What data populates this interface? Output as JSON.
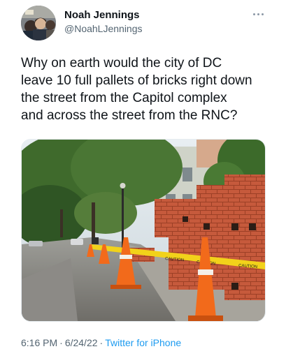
{
  "author": {
    "name": "Noah Jennings",
    "handle": "@NoahLJennings"
  },
  "tweet": {
    "text": "Why on earth would the city of DC\nleave 10 full pallets of bricks right down\nthe street from the Capitol complex\nand across the street from the RNC?"
  },
  "photo": {
    "tape_text_1": "CAUTION",
    "tape_text_2": "CAUTION",
    "tape_text_3": "CAUTION"
  },
  "meta": {
    "time": "6:16 PM",
    "date": "6/24/22",
    "separator": "·",
    "source": "Twitter for iPhone"
  },
  "colors": {
    "name": "#0f1419",
    "secondary": "#536471",
    "link": "#1d9bf0",
    "tape": "#f2d21a",
    "cone": "#f26a1b",
    "brick": "#c3573a"
  },
  "icons": {
    "more": "more-horizontal-icon"
  }
}
